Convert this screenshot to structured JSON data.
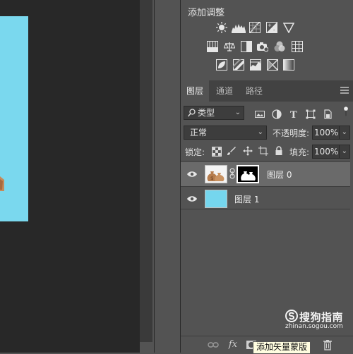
{
  "adjustments": {
    "title": "添加调整",
    "row1_icons": [
      "brightness-contrast-icon",
      "levels-icon",
      "curves-icon",
      "exposure-icon",
      "vibrance-icon"
    ],
    "row2_icons": [
      "hue-saturation-icon",
      "color-balance-icon",
      "black-white-icon",
      "photo-filter-icon",
      "channel-mixer-icon",
      "color-lookup-icon"
    ],
    "row3_icons": [
      "invert-icon",
      "posterize-icon",
      "threshold-icon",
      "selective-color-icon",
      "gradient-map-icon"
    ]
  },
  "layers": {
    "tabs": [
      {
        "label": "图层",
        "active": true
      },
      {
        "label": "通道",
        "active": false
      },
      {
        "label": "路径",
        "active": false
      }
    ],
    "filter": {
      "label": "类型"
    },
    "blend_mode": "正常",
    "opacity_label": "不透明度:",
    "opacity_value": "100%",
    "lock_label": "锁定:",
    "fill_label": "填充:",
    "fill_value": "100%",
    "items": [
      {
        "name": "图层 0",
        "selected": true,
        "visible": true,
        "has_mask": true
      },
      {
        "name": "图层 1",
        "selected": false,
        "visible": true,
        "has_mask": false
      }
    ]
  },
  "bottom_bar": {
    "fx_label": "fx",
    "tooltip": "添加矢量蒙版"
  },
  "watermark": {
    "name": "搜狗指南",
    "url": "zhinan.sogou.com"
  },
  "colors": {
    "canvas_bg": "#282828",
    "document_fill": "#7ad8ee",
    "panel_bg": "#535353",
    "selected_row": "#6a6a6a",
    "layer1_fill": "#75d6ee"
  }
}
